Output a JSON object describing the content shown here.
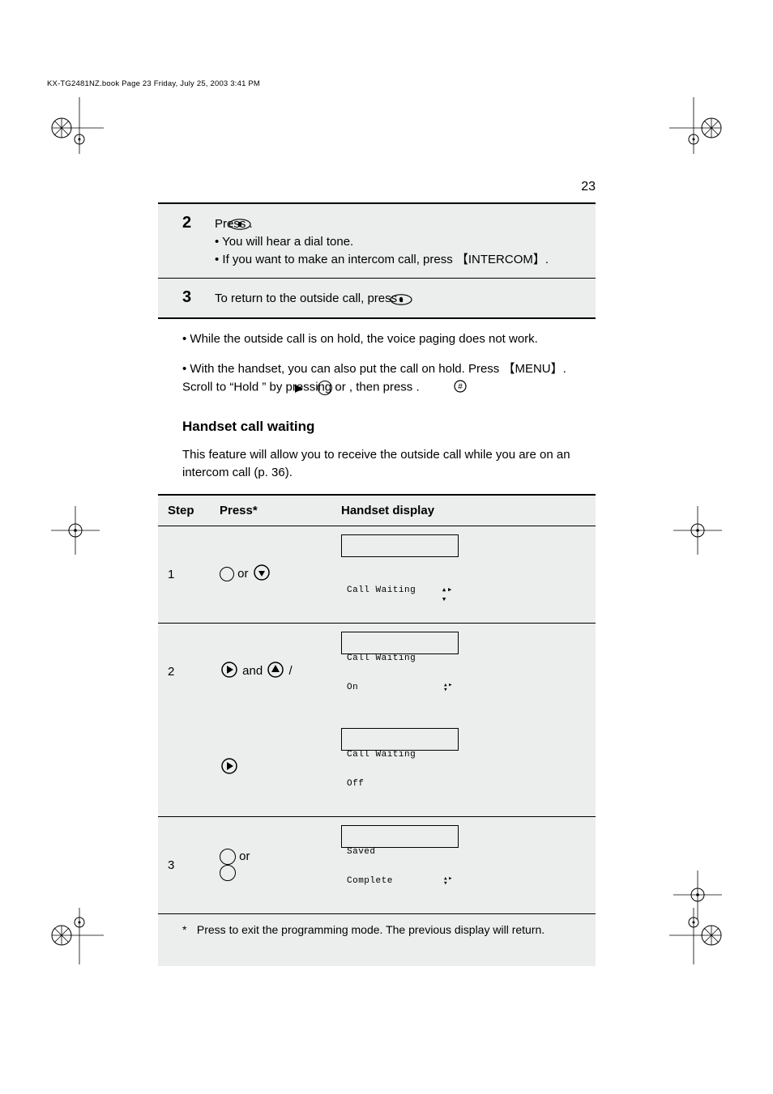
{
  "header_line": "KX-TG2481NZ.book  Page 23  Friday, July 25, 2003  3:41 PM",
  "page_number": "23",
  "section_1": {
    "title": "",
    "step2_num": "2",
    "step2_line1": "Press        .",
    "step2_line2": "• You will hear a dial tone.",
    "step2_line3": "• If you want to make an intercom call, press 【INTERCOM】.",
    "step3_num": "3",
    "step3_text": "To return to the outside call, press        ."
  },
  "body": {
    "p1": "• While the outside call is on hold, the voice paging does not work.",
    "p2": "• With the handset, you can also put the call on hold. Press 【MENU】. Scroll to “Hold ” by pressing     or     , then press     .",
    "h2": "Handset call waiting",
    "p3": "This feature will allow you to receive the outside call while you are on an intercom call (p. 36)."
  },
  "table": {
    "head": {
      "step": "Step",
      "press": "Press*",
      "display": "Handset display"
    },
    "rows": [
      {
        "step": "1",
        "presses": [
          {
            "icon": "circle-empty"
          },
          {
            "text": "or"
          },
          {
            "icon": "circle-down"
          }
        ],
        "lcd": {
          "l1": "           ",
          "l2": "Call Waiting",
          "arrows": true
        }
      },
      {
        "step": "2",
        "presses": [
          {
            "icon": "circle-right"
          },
          {
            "text": "and"
          },
          {
            "icon": "circle-up"
          },
          {
            "text": "/"
          }
        ],
        "lcd": {
          "l1": "Call Waiting",
          "l2": "On",
          "arrows": true
        }
      },
      {
        "step": "",
        "presses": [
          {
            "icon": "circle-right"
          }
        ],
        "lcd": {
          "l1": "Call Waiting",
          "l2": "Off",
          "arrows": false
        }
      },
      {
        "step": "3",
        "presses": [
          {
            "icon": "circle-big",
            "text": "or"
          },
          {
            "icon": "circle-big"
          }
        ],
        "lcd": {
          "l1": "Saved",
          "l2": "Complete",
          "arrows": true
        }
      }
    ]
  },
  "footnote": {
    "star": "*",
    "text": "Press        to exit the programming mode. The previous display will return."
  }
}
